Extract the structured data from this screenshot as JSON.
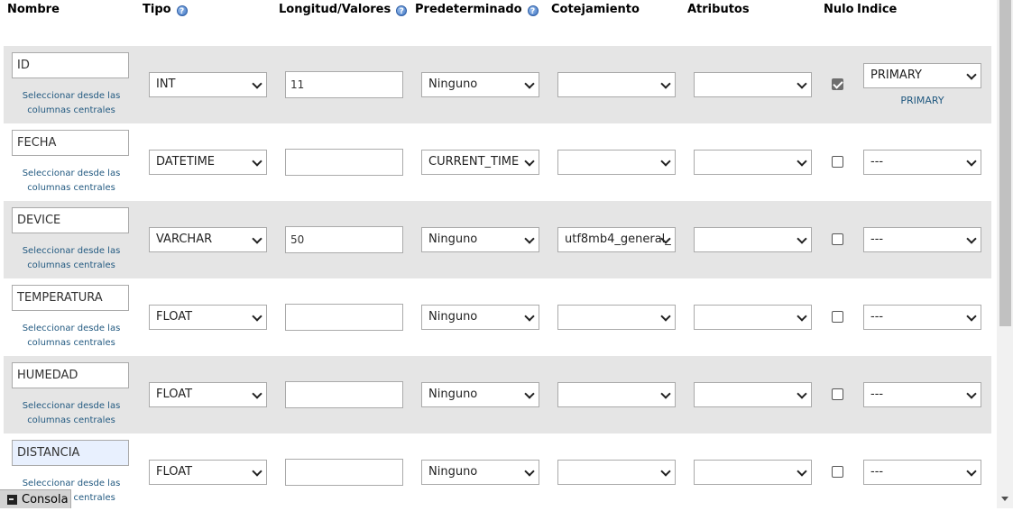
{
  "headers": {
    "nombre": "Nombre",
    "tipo": "Tipo",
    "longitud": "Longitud/Valores",
    "predeterminado": "Predeterminado",
    "cotejamiento": "Cotejamiento",
    "atributos": "Atributos",
    "nulo": "Nulo",
    "indice": "Indice",
    "help_icon": "?"
  },
  "central_link": {
    "line1": "Seleccionar desde las",
    "line2": "columnas centrales"
  },
  "rows": [
    {
      "name": "ID",
      "type": "INT",
      "length": "11",
      "default": "Ninguno",
      "collation": "",
      "attributes": "",
      "null_checked": true,
      "index": "PRIMARY",
      "index_note": "PRIMARY"
    },
    {
      "name": "FECHA",
      "type": "DATETIME",
      "length": "",
      "default": "CURRENT_TIME",
      "collation": "",
      "attributes": "",
      "null_checked": false,
      "index": "---",
      "index_note": ""
    },
    {
      "name": "DEVICE",
      "type": "VARCHAR",
      "length": "50",
      "default": "Ninguno",
      "collation": "utf8mb4_general_",
      "attributes": "",
      "null_checked": false,
      "index": "---",
      "index_note": ""
    },
    {
      "name": "TEMPERATURA",
      "type": "FLOAT",
      "length": "",
      "default": "Ninguno",
      "collation": "",
      "attributes": "",
      "null_checked": false,
      "index": "---",
      "index_note": ""
    },
    {
      "name": "HUMEDAD",
      "type": "FLOAT",
      "length": "",
      "default": "Ninguno",
      "collation": "",
      "attributes": "",
      "null_checked": false,
      "index": "---",
      "index_note": ""
    },
    {
      "name": "DISTANCIA",
      "type": "FLOAT",
      "length": "",
      "default": "Ninguno",
      "collation": "",
      "attributes": "",
      "null_checked": false,
      "index": "---",
      "index_note": ""
    }
  ],
  "console": {
    "label": "Consola"
  },
  "colors": {
    "row_shade": "#e5e5e5",
    "link": "#235a81",
    "focus": "#e8f0fe"
  }
}
